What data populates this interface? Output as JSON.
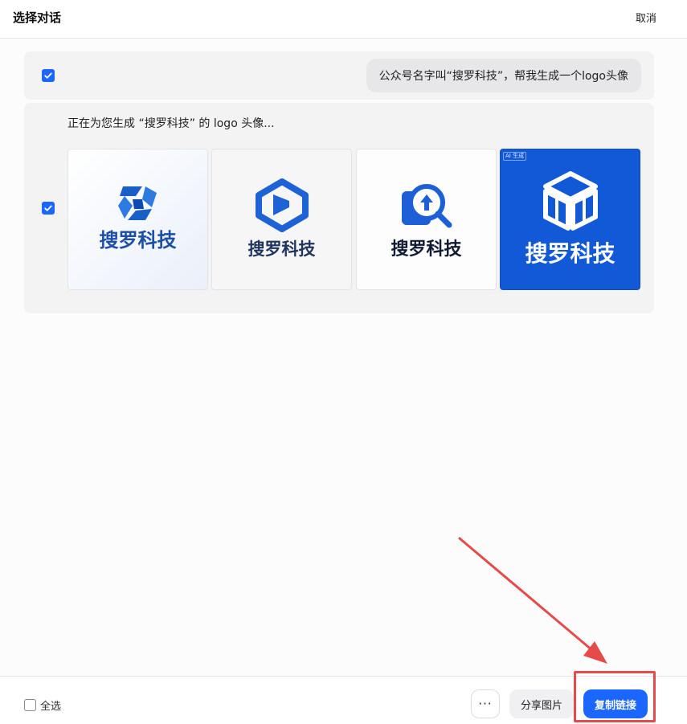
{
  "header": {
    "title": "选择对话",
    "cancel_label": "取消"
  },
  "question": {
    "checked": true,
    "text": "公众号名字叫“搜罗科技”，帮我生成一个logo头像"
  },
  "answer": {
    "checked": true,
    "text": "正在为您生成 “搜罗科技” 的 logo 头像...",
    "images": [
      {
        "brand": "搜罗科技"
      },
      {
        "brand": "搜罗科技"
      },
      {
        "brand": "搜罗科技"
      },
      {
        "brand": "搜罗科技",
        "tag": "AI 生成"
      }
    ]
  },
  "footer": {
    "select_all_label": "全选",
    "more_label": "···",
    "share_label": "分享图片",
    "copy_label": "复制链接"
  },
  "colors": {
    "accent": "#1a66ff",
    "annotation": "#e64b4b"
  }
}
